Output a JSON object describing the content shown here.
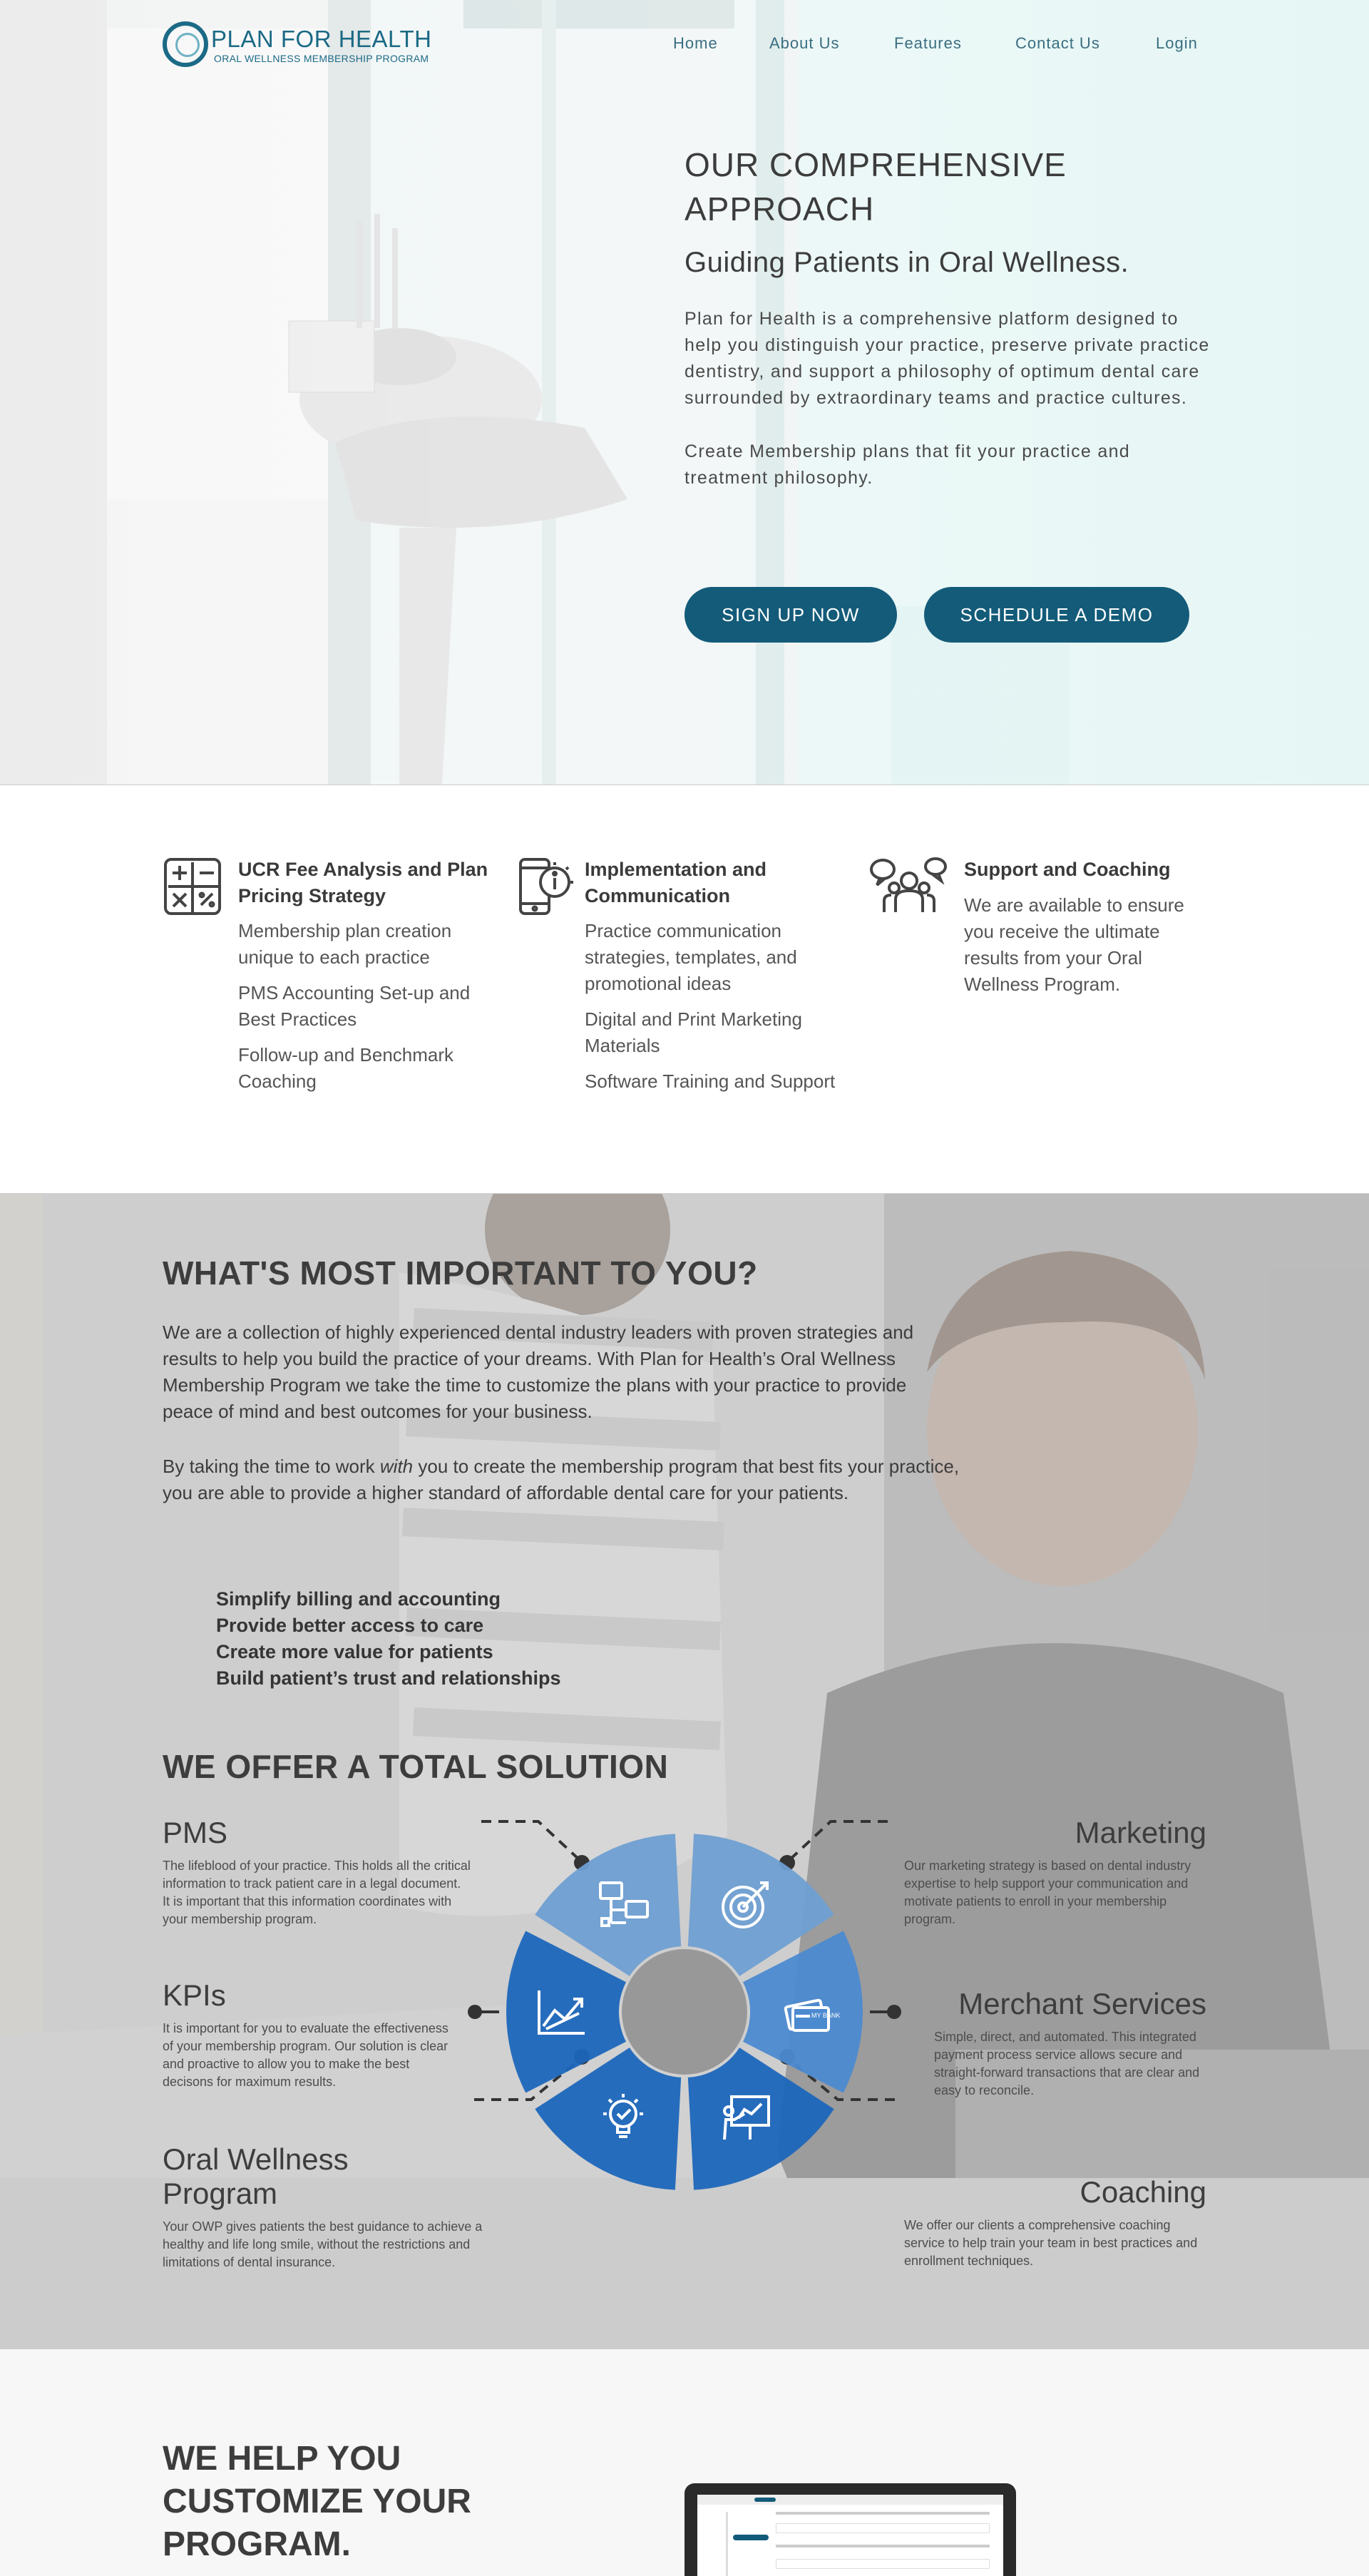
{
  "brand": {
    "name": "PLAN FOR HEALTH",
    "tagline": "ORAL WELLNESS MEMBERSHIP PROGRAM",
    "reg": "®",
    "color": "#1b6a86"
  },
  "nav": {
    "items": [
      "Home",
      "About Us",
      "Features",
      "Contact Us",
      "Login"
    ]
  },
  "hero": {
    "title": "OUR COMPREHENSIVE APPROACH",
    "subtitle": "Guiding Patients in Oral Wellness.",
    "para1": "Plan for Health is a comprehensive platform designed to help you distinguish your practice, preserve private practice dentistry, and support a philosophy of optimum dental care surrounded by extraordinary teams and practice cultures.",
    "para2": "Create Membership plans that fit your practice and treatment philosophy.",
    "cta_primary": "SIGN UP NOW",
    "cta_secondary": "SCHEDULE A DEMO",
    "button_color": "#135b79"
  },
  "features": [
    {
      "icon": "calculator-icon",
      "title": "UCR Fee Analysis and Plan Pricing Strategy",
      "items": [
        "Membership plan creation unique to each practice",
        "PMS Accounting Set-up and Best Practices",
        "Follow-up and Benchmark Coaching"
      ]
    },
    {
      "icon": "phone-info-icon",
      "title": "Implementation and Communication",
      "items": [
        "Practice communication strategies, templates, and promotional ideas",
        "Digital and Print Marketing Materials",
        "Software Training and Support"
      ]
    },
    {
      "icon": "people-chat-icon",
      "title": "Support and Coaching",
      "items": [
        "We are available to ensure you receive the ultimate results from your Oral Wellness Program."
      ]
    }
  ],
  "important": {
    "title": "WHAT'S MOST IMPORTANT TO YOU?",
    "para1": "We are a collection of highly experienced dental industry leaders with proven strategies and results to help you build the practice of your dreams. With Plan for Health’s Oral Wellness Membership Program we take the time to customize the plans with your practice to provide peace of mind and best outcomes for your business.",
    "para2_pre": "By taking the time to work ",
    "para2_em": "with",
    "para2_post": " you to create the membership program that best fits your practice, you are able to provide a higher standard of affordable dental care for your patients.",
    "bullets": [
      "Simplify billing and accounting",
      "Provide better access to care",
      "Create more value for patients",
      "Build patient’s trust and relationships"
    ]
  },
  "solution": {
    "title": "WE OFFER A TOTAL SOLUTION",
    "left": [
      {
        "title": "PMS",
        "text": "The lifeblood of your practice. This holds all the critical information to track patient care in a legal document.\nIt is important that this information coordinates with your membership program."
      },
      {
        "title": "KPIs",
        "text": "It is important for you to evaluate the effectiveness of your membership program. Our solution is clear and proactive to allow you to make the best decisons for maximum results."
      },
      {
        "title": "Oral Wellness Program",
        "text": "Your OWP gives patients the best guidance to achieve a healthy and life long smile, without the restrictions and limitations of dental insurance."
      }
    ],
    "right": [
      {
        "title": "Marketing",
        "text": "Our marketing strategy is based on dental industry expertise to help support your communication and motivate patients to enroll in your membership program."
      },
      {
        "title": "Merchant Services",
        "text": "Simple, direct, and automated. This integrated payment process service allows secure and straight-forward transactions that are clear and easy to reconcile."
      },
      {
        "title": "Coaching",
        "text": "We offer our clients a comprehensive coaching service to help train your team in best practices and enrollment techniques."
      }
    ],
    "segment_icons": [
      "network-computers-icon",
      "target-icon",
      "credit-card-icon",
      "presentation-icon",
      "lightbulb-icon",
      "growth-chart-icon"
    ],
    "card_label": "MY BANK",
    "colors": {
      "light": "#6f9fd2",
      "mid": "#4c8ad0",
      "dark": "#1c66ba"
    }
  },
  "customize": {
    "title": "WE HELP YOU CUSTOMIZE YOUR PROGRAM."
  }
}
